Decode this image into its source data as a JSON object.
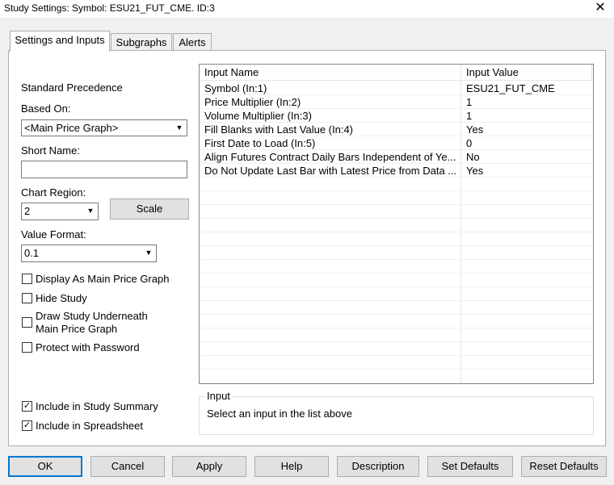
{
  "window": {
    "title": "Study Settings: Symbol: ESU21_FUT_CME. ID:3",
    "close_glyph": "✕"
  },
  "tabs": [
    {
      "label": "Settings and Inputs"
    },
    {
      "label": "Subgraphs"
    },
    {
      "label": "Alerts"
    }
  ],
  "left": {
    "standard_precedence": "Standard Precedence",
    "based_on_label": "Based On:",
    "based_on_value": "<Main Price Graph>",
    "short_name_label": "Short Name:",
    "short_name_value": "",
    "chart_region_label": "Chart Region:",
    "chart_region_value": "2",
    "scale_button": "Scale",
    "value_format_label": "Value Format:",
    "value_format_value": "0.1",
    "checkboxes": [
      {
        "label": "Display As Main Price Graph",
        "checked": false
      },
      {
        "label": "Hide Study",
        "checked": false
      },
      {
        "label": "Draw Study Underneath",
        "label2": "Main Price Graph",
        "checked": false
      },
      {
        "label": "Protect with Password",
        "checked": false
      }
    ],
    "bottom_checkboxes": [
      {
        "label": "Include in Study Summary",
        "checked": true
      },
      {
        "label": "Include in Spreadsheet",
        "checked": true
      }
    ]
  },
  "inputs_table": {
    "columns": [
      "Input Name",
      "Input Value"
    ],
    "rows": [
      {
        "name": "Symbol  (In:1)",
        "value": "ESU21_FUT_CME"
      },
      {
        "name": "Price Multiplier  (In:2)",
        "value": "1"
      },
      {
        "name": "Volume Multiplier  (In:3)",
        "value": "1"
      },
      {
        "name": "Fill Blanks with Last Value  (In:4)",
        "value": "Yes"
      },
      {
        "name": "First Date to Load  (In:5)",
        "value": "0"
      },
      {
        "name": "Align Futures Contract Daily Bars Independent of Ye...",
        "value": "No"
      },
      {
        "name": "Do Not Update Last Bar with Latest Price from Data ...",
        "value": "Yes"
      }
    ]
  },
  "input_group": {
    "title": "Input",
    "text": "Select an input in the list above"
  },
  "buttons": {
    "ok": "OK",
    "cancel": "Cancel",
    "apply": "Apply",
    "help": "Help",
    "description": "Description",
    "set_defaults": "Set Defaults",
    "reset_defaults": "Reset Defaults"
  }
}
